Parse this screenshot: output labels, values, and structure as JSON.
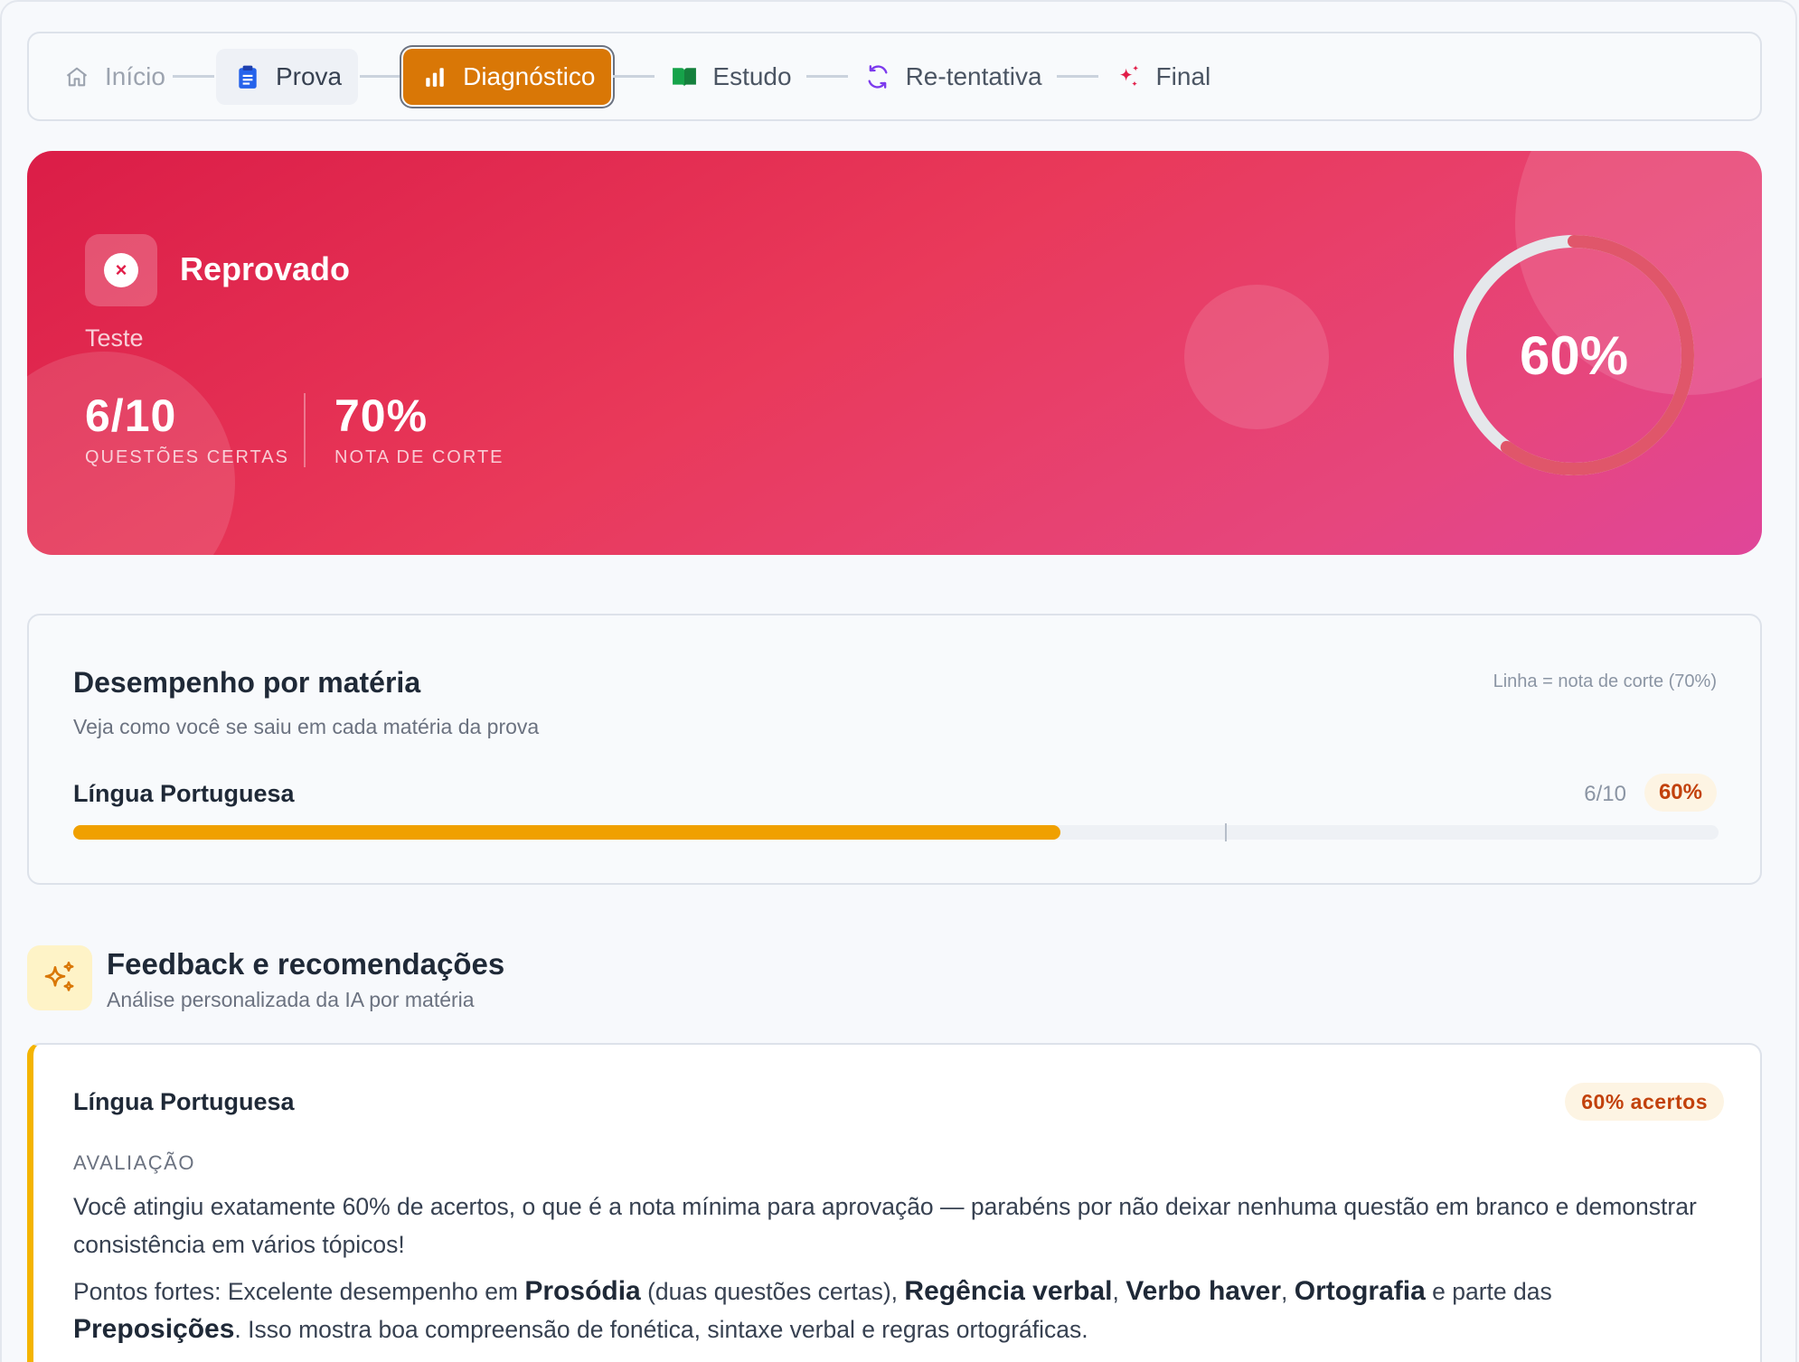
{
  "stepper": {
    "steps": [
      {
        "label": "Início",
        "icon": "home-icon",
        "state": "done"
      },
      {
        "label": "Prova",
        "icon": "clipboard-icon",
        "state": "done"
      },
      {
        "label": "Diagnóstico",
        "icon": "bar-chart-icon",
        "state": "active"
      },
      {
        "label": "Estudo",
        "icon": "book-open-icon",
        "state": "pending"
      },
      {
        "label": "Re-tentativa",
        "icon": "refresh-icon",
        "state": "pending"
      },
      {
        "label": "Final",
        "icon": "sparkles-icon",
        "state": "pending"
      }
    ]
  },
  "hero": {
    "status": "Reprovado",
    "exam_name": "Teste",
    "correct_value": "6/10",
    "correct_label": "QUESTÕES CERTAS",
    "cutoff_value": "70%",
    "cutoff_label": "NOTA DE CORTE",
    "score_percent_text": "60%",
    "score_fraction": 0.6,
    "colors": {
      "gradient_start": "#db1d47",
      "gradient_end": "#e04699"
    }
  },
  "performance": {
    "title": "Desempenho por matéria",
    "subtitle": "Veja como você se saiu em cada matéria da prova",
    "legend": "Linha = nota de corte (70%)",
    "subjects": [
      {
        "name": "Língua Portuguesa",
        "score": "6/10",
        "percent": "60%",
        "fraction": 0.6,
        "cutoff_fraction": 0.7,
        "bar_color": "#f0a000"
      }
    ]
  },
  "feedback": {
    "title": "Feedback e recomendações",
    "subtitle": "Análise personalizada da IA por matéria",
    "cards": [
      {
        "subject": "Língua Portuguesa",
        "badge": "60% acertos",
        "section_label": "AVALIAÇÃO",
        "evaluation": "Você atingiu exatamente 60% de acertos, o que é a nota mínima para aprovação — parabéns por não deixar nenhuma questão em branco e demonstrar consistência em vários tópicos!",
        "strengths": {
          "prefix": "Pontos fortes: Excelente desempenho em ",
          "t1": "Prosódia",
          "mid1": " (duas questões certas), ",
          "t2": "Regência verbal",
          "sep1": ", ",
          "t3": "Verbo haver",
          "sep2": ", ",
          "t4": "Ortografia",
          "mid2": " e parte das ",
          "t5": "Preposições",
          "suffix": ". Isso mostra boa compreensão de fonética, sintaxe verbal e regras ortográficas."
        }
      }
    ]
  }
}
